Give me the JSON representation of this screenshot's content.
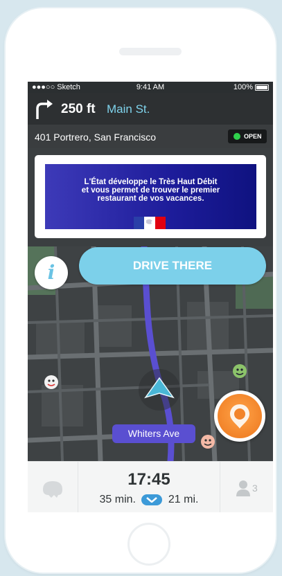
{
  "status_bar": {
    "carrier": "●●●○○ Sketch",
    "time": "9:41 AM",
    "battery": "100%"
  },
  "navigation": {
    "distance": "250 ft",
    "street": "Main St.",
    "turn_icon": "turn-right-arrow-icon"
  },
  "destination": {
    "address": "401 Portrero, San Francisco",
    "status": "OPEN",
    "status_color": "#2fd14c"
  },
  "ad": {
    "text_line1": "L'État développe le Très Haut Débit",
    "text_line2": "et vous permet de trouver le premier",
    "text_line3": "restaurant de vos vacances."
  },
  "actions": {
    "info_label": "i",
    "drive_label": "DRIVE THERE"
  },
  "map": {
    "current_street": "Whiters Ave",
    "route_color": "#5a4fd1"
  },
  "bottom_bar": {
    "eta": "17:45",
    "duration": "35 min.",
    "distance": "21 mi.",
    "riders": "3"
  },
  "colors": {
    "accent": "#7cd0ea",
    "orange": "#f2842a"
  }
}
